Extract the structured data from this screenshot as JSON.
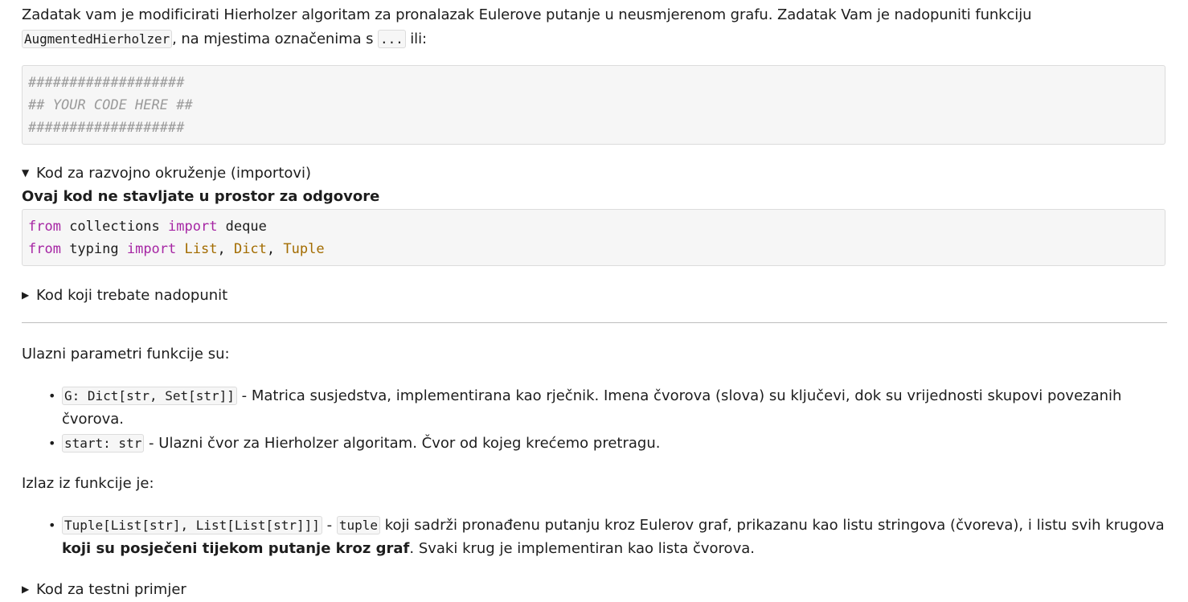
{
  "intro": {
    "text_before": "Zadatak vam je modificirati Hierholzer algoritam za pronalazak Eulerove putanje u neusmjerenom grafu. Zadatak Vam je nadopuniti funkciju ",
    "func_name": "AugmentedHierholzer",
    "text_middle": ", na mjestima označenima s ",
    "ellipsis": "...",
    "text_after": " ili:"
  },
  "placeholder_block": {
    "line1": "###################",
    "line2": "## YOUR CODE HERE ##",
    "line3": "###################"
  },
  "details_env": {
    "triangle": "▼",
    "summary": "Kod za razvojno okruženje (importovi)",
    "note": "Ovaj kod ne stavljate u prostor za odgovore",
    "code": {
      "l1_from": "from",
      "l1_mod": " collections ",
      "l1_import": "import",
      "l1_name": " deque",
      "l2_from": "from",
      "l2_mod": " typing ",
      "l2_import": "import",
      "l2_t1": "List",
      "l2_sep1": ", ",
      "l2_t2": "Dict",
      "l2_sep2": ", ",
      "l2_t3": "Tuple"
    }
  },
  "details_todo": {
    "triangle": "▶",
    "summary": "Kod koji trebate nadopunit"
  },
  "inputs": {
    "heading": "Ulazni parametri funkcije su:",
    "items": [
      {
        "code": "G: Dict[str, Set[str]]",
        "text": " - Matrica susjedstva, implementirana kao rječnik. Imena čvorova (slova) su ključevi, dok su vrijednosti skupovi povezanih čvorova."
      },
      {
        "code": "start: str",
        "text": " - Ulazni čvor za Hierholzer algoritam. Čvor od kojeg krećemo pretragu."
      }
    ]
  },
  "output": {
    "heading": "Izlaz iz funkcije je:",
    "item": {
      "code": "Tuple[List[str], List[List[str]]]",
      "sep": " - ",
      "code2": "tuple",
      "text": " koji sadrži pronađenu putanju kroz Eulerov graf, prikazanu kao listu stringova (čvoreva), i listu svih krugova ",
      "bold": "koji su posječeni tijekom putanje kroz graf",
      "text_end": ". Svaki krug je implementiran kao lista čvorova."
    }
  },
  "details_test": {
    "triangle": "▶",
    "summary": "Kod za testni primjer"
  },
  "bullet": "•"
}
